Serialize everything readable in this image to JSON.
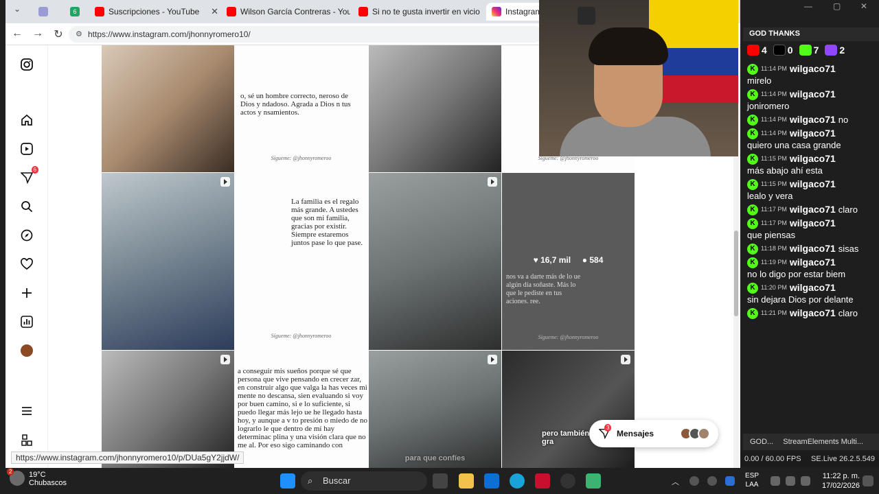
{
  "browser": {
    "tabs": [
      {
        "label": "6",
        "favicon_color": "#1fa463"
      },
      {
        "label": "Suscripciones - YouTube",
        "favicon_color": "#ff0000"
      },
      {
        "label": "Wilson García Contreras - YouTu",
        "favicon_color": "#ff0000"
      },
      {
        "label": "Si no te gusta invertir en vicio",
        "favicon_color": "#ff0000"
      },
      {
        "label": "Instagram",
        "favicon_color": "#d6249f"
      }
    ],
    "url": "https://www.instagram.com/jhonnyromero10/",
    "status_url": "https://www.instagram.com/jhonnyromero10/p/DUa5gY2jjdW/"
  },
  "sidebar": {
    "notifications_badge": "6"
  },
  "grid": {
    "text_card_1": "o, sé un hombre correcto, neroso de Dios y ndadoso. Agrada a Dios n tus actos y nsamientos.",
    "text_card_2": "La familia es el regalo más grande. A ustedes que son mi familia, gracias por existir. Siempre estaremos juntos pase lo que pase.",
    "text_card_3": "a conseguir mis sueños porque sé que persona que vive pensando en crecer zar, en construir algo que valga la has veces mi mente no descansa, sien evaluando si voy por buen camino, si e lo suficiente, si puedo llegar más lejo ue he llegado hasta hoy, y aunque a v to presión o miedo de no lograrlo le que dentro de mí hay determinac plina y una visión clara que no me al. Por eso sigo caminando con",
    "hover_text": "nos va a darte más de lo ue algún día soñaste. Más lo que le pediste en tus aciones. ree.",
    "signature": "Sígueme: @jhonnyromeroo",
    "likes": "16,7 mil",
    "comments": "584",
    "reel_caption_1": "para que confíes",
    "reel_caption_2": "pero también sueñas en gra"
  },
  "messages_pill": {
    "label": "Mensajes",
    "badge": "3"
  },
  "chat": {
    "title": "GOD THANKS",
    "counts": {
      "youtube": "4",
      "tiktok": "0",
      "kick": "7",
      "twitch": "2"
    },
    "messages": [
      {
        "time": "11:14 PM",
        "user": "wilgaco71",
        "text": "mirelo"
      },
      {
        "time": "11:14 PM",
        "user": "wilgaco71",
        "text": "joniromero"
      },
      {
        "time": "11:14 PM",
        "user": "wilgaco71",
        "text": "no"
      },
      {
        "time": "11:14 PM",
        "user": "wilgaco71",
        "text": "quiero una casa grande"
      },
      {
        "time": "11:15 PM",
        "user": "wilgaco71",
        "text": "más abajo ahí esta"
      },
      {
        "time": "11:15 PM",
        "user": "wilgaco71",
        "text": "lealo y vera"
      },
      {
        "time": "11:17 PM",
        "user": "wilgaco71",
        "text": "claro"
      },
      {
        "time": "11:17 PM",
        "user": "wilgaco71",
        "text": "que piensas"
      },
      {
        "time": "11:18 PM",
        "user": "wilgaco71",
        "text": "sisas"
      },
      {
        "time": "11:19 PM",
        "user": "wilgaco71",
        "text": "no lo digo por estar biem"
      },
      {
        "time": "11:20 PM",
        "user": "wilgaco71",
        "text": "sin dejara Dios por delante"
      },
      {
        "time": "11:21 PM",
        "user": "wilgaco71",
        "text": "claro"
      }
    ],
    "obs_tab_1": "GOD...",
    "obs_tab_2": "StreamElements Multi...",
    "fps": "0.00 / 60.00 FPS",
    "version": "SE.Live 26.2.5.549"
  },
  "taskbar": {
    "weather_temp": "19°C",
    "weather_desc": "Chubascos",
    "weather_badge": "2",
    "search_placeholder": "Buscar",
    "lang_1": "ESP",
    "lang_2": "LAA",
    "time": "11:22 p. m.",
    "date": "17/02/2026"
  }
}
